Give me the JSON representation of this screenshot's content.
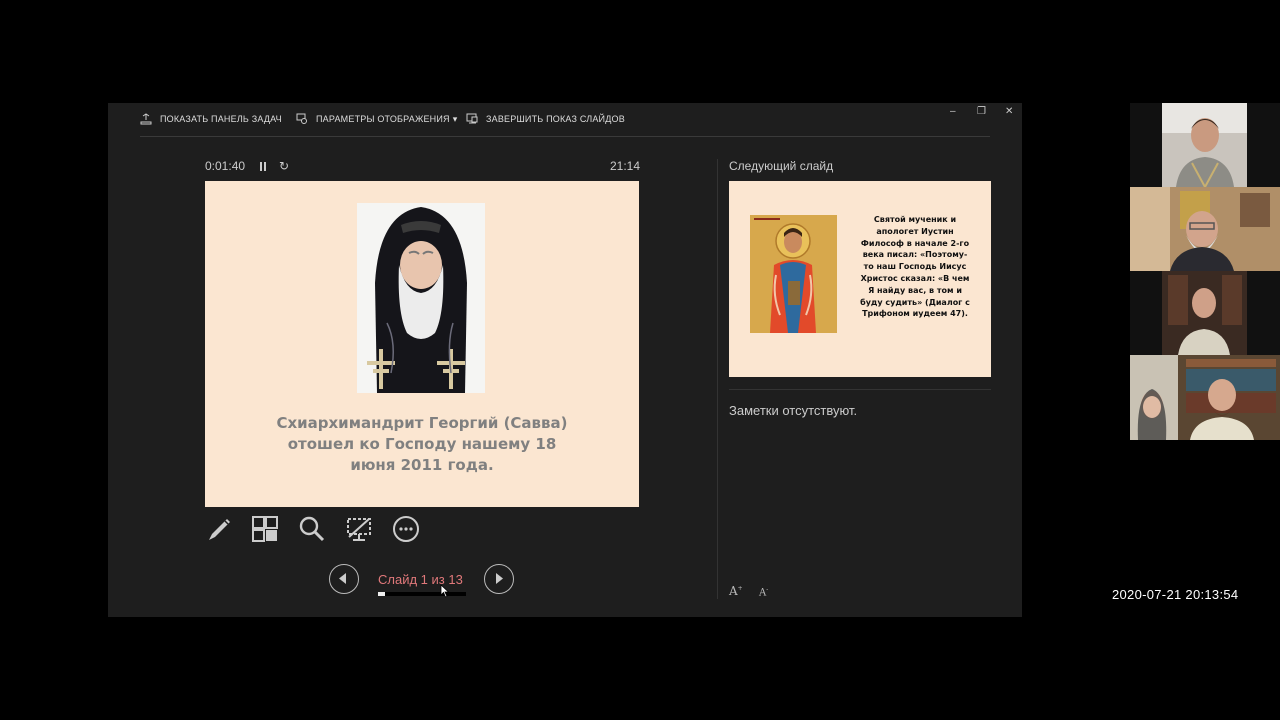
{
  "toolbar": {
    "show_taskbar": "ПОКАЗАТЬ ПАНЕЛЬ ЗАДАЧ",
    "display_settings": "ПАРАМЕТРЫ ОТОБРАЖЕНИЯ",
    "display_settings_arrow": "▾",
    "end_slideshow": "ЗАВЕРШИТЬ ПОКАЗ СЛАЙДОВ",
    "minimize": "–",
    "restore": "❐",
    "close": "✕"
  },
  "timer": {
    "elapsed": "0:01:40",
    "reset_glyph": "↻",
    "clock": "21:14"
  },
  "current_slide": {
    "caption_lines": [
      "Схиархимандрит Георгий (Савва)",
      "отошел ко Господу нашему 18",
      "июня 2011 года."
    ]
  },
  "navigation": {
    "slide_counter": "Слайд 1 из 13",
    "progress_fraction": 0.077
  },
  "next_slide": {
    "label": "Следующий слайд",
    "text_lines": [
      "Святой мученик и",
      "апологет Иустин",
      "Философ в начале 2-го",
      "века писал: «Поэтому-",
      "то наш Господь Иисус",
      "Христос сказал: «В чем",
      "Я найду вас, в том и",
      "буду судить» (Диалог с",
      "Трифоном иудеем 47)."
    ]
  },
  "notes": {
    "text": "Заметки отсутствуют.",
    "increase_font": "A",
    "decrease_font": "A"
  },
  "overlay": {
    "timestamp": "2020-07-21  20:13:54"
  },
  "colors": {
    "presenter_bg": "#1e1e1e",
    "slide_bg": "#fbe6d1",
    "accent_red": "#e0787a",
    "caption_gray": "#808080"
  }
}
